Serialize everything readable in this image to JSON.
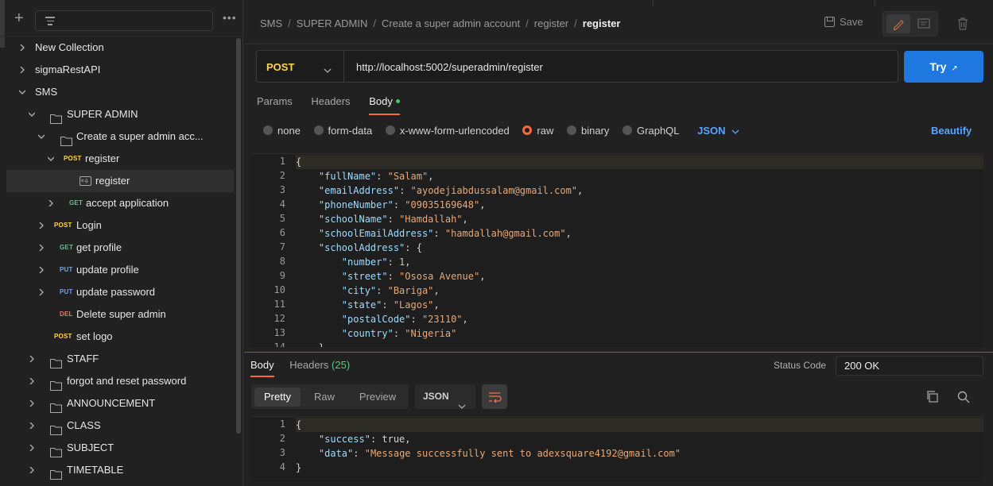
{
  "sidebar": {
    "filter_placeholder": "",
    "tree": [
      {
        "label": "New Collection",
        "type": "collection"
      },
      {
        "label": "sigmaRestAPI",
        "type": "collection"
      },
      {
        "label": "SMS",
        "type": "collection"
      },
      {
        "label": "SUPER ADMIN",
        "type": "folder"
      },
      {
        "label": "Create a super admin acc...",
        "type": "folder"
      },
      {
        "label": "register",
        "type": "request",
        "method": "POST"
      },
      {
        "label": "register",
        "type": "example"
      },
      {
        "label": "accept application",
        "type": "request",
        "method": "GET"
      },
      {
        "label": "Login",
        "type": "request",
        "method": "POST"
      },
      {
        "label": "get profile",
        "type": "request",
        "method": "GET"
      },
      {
        "label": "update profile",
        "type": "request",
        "method": "PUT"
      },
      {
        "label": "update password",
        "type": "request",
        "method": "PUT"
      },
      {
        "label": "Delete super admin",
        "type": "request",
        "method": "DEL"
      },
      {
        "label": "set logo",
        "type": "request",
        "method": "POST"
      },
      {
        "label": "STAFF",
        "type": "folder"
      },
      {
        "label": "forgot and reset password",
        "type": "folder"
      },
      {
        "label": "ANNOUNCEMENT",
        "type": "folder"
      },
      {
        "label": "CLASS",
        "type": "folder"
      },
      {
        "label": "SUBJECT",
        "type": "folder"
      },
      {
        "label": "TIMETABLE",
        "type": "folder"
      }
    ]
  },
  "breadcrumb": [
    "SMS",
    "SUPER ADMIN",
    "Create a super admin account",
    "register",
    "register"
  ],
  "toolbar": {
    "save_label": "Save"
  },
  "request": {
    "method": "POST",
    "url": "http://localhost:5002/superadmin/register",
    "send_label": "Try",
    "send_icon": "↗",
    "tabs": [
      "Params",
      "Headers",
      "Body"
    ],
    "active_tab": "Body",
    "body_types": [
      "none",
      "form-data",
      "x-www-form-urlencoded",
      "raw",
      "binary",
      "GraphQL"
    ],
    "selected_body_type": "raw",
    "raw_format": "JSON",
    "beautify_label": "Beautify",
    "body_lines": [
      "{",
      "    \"fullName\": \"Salam\",",
      "    \"emailAddress\": \"ayodejiabdussalam@gmail.com\",",
      "    \"phoneNumber\": \"09035169648\",",
      "    \"schoolName\": \"Hamdallah\",",
      "    \"schoolEmailAddress\": \"hamdallah@gmail.com\",",
      "    \"schoolAddress\": {",
      "        \"number\": 1,",
      "        \"street\": \"Ososa Avenue\",",
      "        \"city\": \"Bariga\",",
      "        \"state\": \"Lagos\",",
      "        \"postalCode\": \"23110\",",
      "        \"country\": \"Nigeria\"",
      "    }"
    ]
  },
  "response": {
    "tabs": [
      {
        "label": "Body"
      },
      {
        "label": "Headers",
        "count": "(25)"
      }
    ],
    "status_label": "Status Code",
    "status_value": "200 OK",
    "view_modes": [
      "Pretty",
      "Raw",
      "Preview"
    ],
    "active_view": "Pretty",
    "format": "JSON",
    "body_lines": [
      "{",
      "    \"success\": true,",
      "    \"data\": \"Message successfully sent to adexsquare4192@gmail.com\"",
      "}"
    ]
  },
  "colors": {
    "accent": "#f26b3a",
    "primary": "#1f78e0",
    "post": "#ffd54a",
    "get": "#6bbf8e",
    "put": "#6ea6e8",
    "del": "#e07b6b"
  }
}
